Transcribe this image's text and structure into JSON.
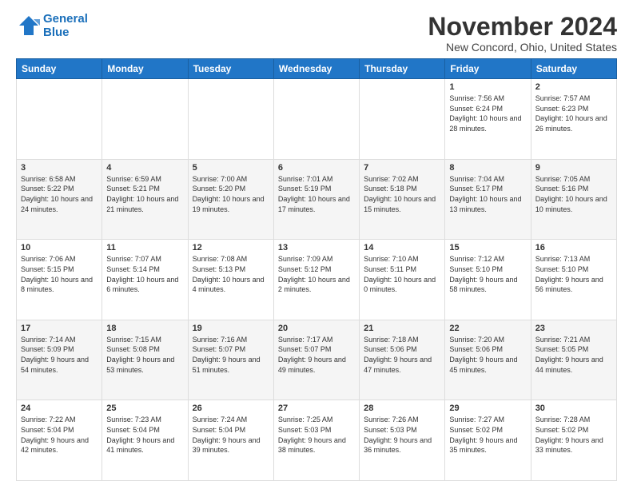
{
  "logo": {
    "line1": "General",
    "line2": "Blue"
  },
  "title": "November 2024",
  "location": "New Concord, Ohio, United States",
  "days_of_week": [
    "Sunday",
    "Monday",
    "Tuesday",
    "Wednesday",
    "Thursday",
    "Friday",
    "Saturday"
  ],
  "weeks": [
    [
      {
        "day": "",
        "info": ""
      },
      {
        "day": "",
        "info": ""
      },
      {
        "day": "",
        "info": ""
      },
      {
        "day": "",
        "info": ""
      },
      {
        "day": "",
        "info": ""
      },
      {
        "day": "1",
        "info": "Sunrise: 7:56 AM\nSunset: 6:24 PM\nDaylight: 10 hours and 28 minutes."
      },
      {
        "day": "2",
        "info": "Sunrise: 7:57 AM\nSunset: 6:23 PM\nDaylight: 10 hours and 26 minutes."
      }
    ],
    [
      {
        "day": "3",
        "info": "Sunrise: 6:58 AM\nSunset: 5:22 PM\nDaylight: 10 hours and 24 minutes."
      },
      {
        "day": "4",
        "info": "Sunrise: 6:59 AM\nSunset: 5:21 PM\nDaylight: 10 hours and 21 minutes."
      },
      {
        "day": "5",
        "info": "Sunrise: 7:00 AM\nSunset: 5:20 PM\nDaylight: 10 hours and 19 minutes."
      },
      {
        "day": "6",
        "info": "Sunrise: 7:01 AM\nSunset: 5:19 PM\nDaylight: 10 hours and 17 minutes."
      },
      {
        "day": "7",
        "info": "Sunrise: 7:02 AM\nSunset: 5:18 PM\nDaylight: 10 hours and 15 minutes."
      },
      {
        "day": "8",
        "info": "Sunrise: 7:04 AM\nSunset: 5:17 PM\nDaylight: 10 hours and 13 minutes."
      },
      {
        "day": "9",
        "info": "Sunrise: 7:05 AM\nSunset: 5:16 PM\nDaylight: 10 hours and 10 minutes."
      }
    ],
    [
      {
        "day": "10",
        "info": "Sunrise: 7:06 AM\nSunset: 5:15 PM\nDaylight: 10 hours and 8 minutes."
      },
      {
        "day": "11",
        "info": "Sunrise: 7:07 AM\nSunset: 5:14 PM\nDaylight: 10 hours and 6 minutes."
      },
      {
        "day": "12",
        "info": "Sunrise: 7:08 AM\nSunset: 5:13 PM\nDaylight: 10 hours and 4 minutes."
      },
      {
        "day": "13",
        "info": "Sunrise: 7:09 AM\nSunset: 5:12 PM\nDaylight: 10 hours and 2 minutes."
      },
      {
        "day": "14",
        "info": "Sunrise: 7:10 AM\nSunset: 5:11 PM\nDaylight: 10 hours and 0 minutes."
      },
      {
        "day": "15",
        "info": "Sunrise: 7:12 AM\nSunset: 5:10 PM\nDaylight: 9 hours and 58 minutes."
      },
      {
        "day": "16",
        "info": "Sunrise: 7:13 AM\nSunset: 5:10 PM\nDaylight: 9 hours and 56 minutes."
      }
    ],
    [
      {
        "day": "17",
        "info": "Sunrise: 7:14 AM\nSunset: 5:09 PM\nDaylight: 9 hours and 54 minutes."
      },
      {
        "day": "18",
        "info": "Sunrise: 7:15 AM\nSunset: 5:08 PM\nDaylight: 9 hours and 53 minutes."
      },
      {
        "day": "19",
        "info": "Sunrise: 7:16 AM\nSunset: 5:07 PM\nDaylight: 9 hours and 51 minutes."
      },
      {
        "day": "20",
        "info": "Sunrise: 7:17 AM\nSunset: 5:07 PM\nDaylight: 9 hours and 49 minutes."
      },
      {
        "day": "21",
        "info": "Sunrise: 7:18 AM\nSunset: 5:06 PM\nDaylight: 9 hours and 47 minutes."
      },
      {
        "day": "22",
        "info": "Sunrise: 7:20 AM\nSunset: 5:06 PM\nDaylight: 9 hours and 45 minutes."
      },
      {
        "day": "23",
        "info": "Sunrise: 7:21 AM\nSunset: 5:05 PM\nDaylight: 9 hours and 44 minutes."
      }
    ],
    [
      {
        "day": "24",
        "info": "Sunrise: 7:22 AM\nSunset: 5:04 PM\nDaylight: 9 hours and 42 minutes."
      },
      {
        "day": "25",
        "info": "Sunrise: 7:23 AM\nSunset: 5:04 PM\nDaylight: 9 hours and 41 minutes."
      },
      {
        "day": "26",
        "info": "Sunrise: 7:24 AM\nSunset: 5:04 PM\nDaylight: 9 hours and 39 minutes."
      },
      {
        "day": "27",
        "info": "Sunrise: 7:25 AM\nSunset: 5:03 PM\nDaylight: 9 hours and 38 minutes."
      },
      {
        "day": "28",
        "info": "Sunrise: 7:26 AM\nSunset: 5:03 PM\nDaylight: 9 hours and 36 minutes."
      },
      {
        "day": "29",
        "info": "Sunrise: 7:27 AM\nSunset: 5:02 PM\nDaylight: 9 hours and 35 minutes."
      },
      {
        "day": "30",
        "info": "Sunrise: 7:28 AM\nSunset: 5:02 PM\nDaylight: 9 hours and 33 minutes."
      }
    ]
  ]
}
